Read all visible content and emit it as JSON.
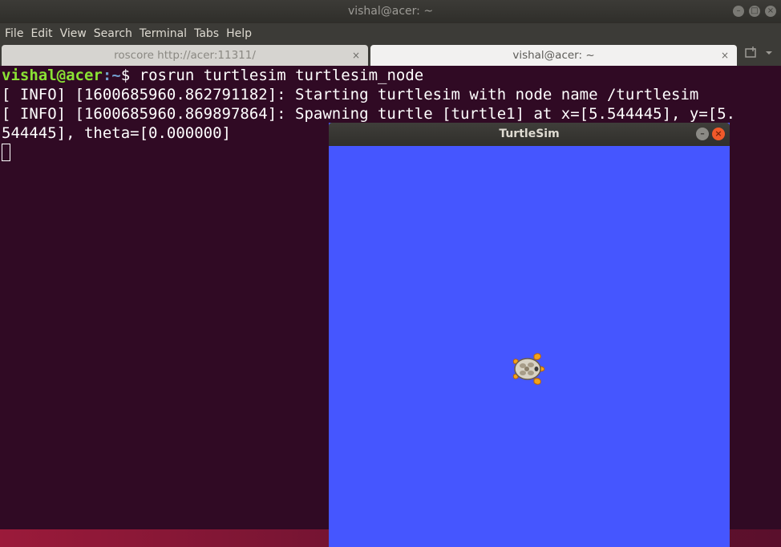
{
  "terminal": {
    "window_title": "vishal@acer: ~",
    "menu": [
      "File",
      "Edit",
      "View",
      "Search",
      "Terminal",
      "Tabs",
      "Help"
    ],
    "tabs": [
      {
        "label": "roscore http://acer:11311/",
        "close": "×"
      },
      {
        "label": "vishal@acer: ~",
        "close": "×"
      }
    ],
    "prompt": {
      "user_host": "vishal@acer",
      "path": ":~",
      "symbol": "$",
      "command": " rosrun turtlesim turtlesim_node"
    },
    "output_lines": [
      "[ INFO] [1600685960.862791182]: Starting turtlesim with node name /turtlesim",
      "[ INFO] [1600685960.869897864]: Spawning turtle [turtle1] at x=[5.544445], y=[5.",
      "544445], theta=[0.000000]"
    ]
  },
  "turtlesim": {
    "window_title": "TurtleSim",
    "background_color": "#4556ff",
    "turtle_icon": "turtle-icon"
  }
}
